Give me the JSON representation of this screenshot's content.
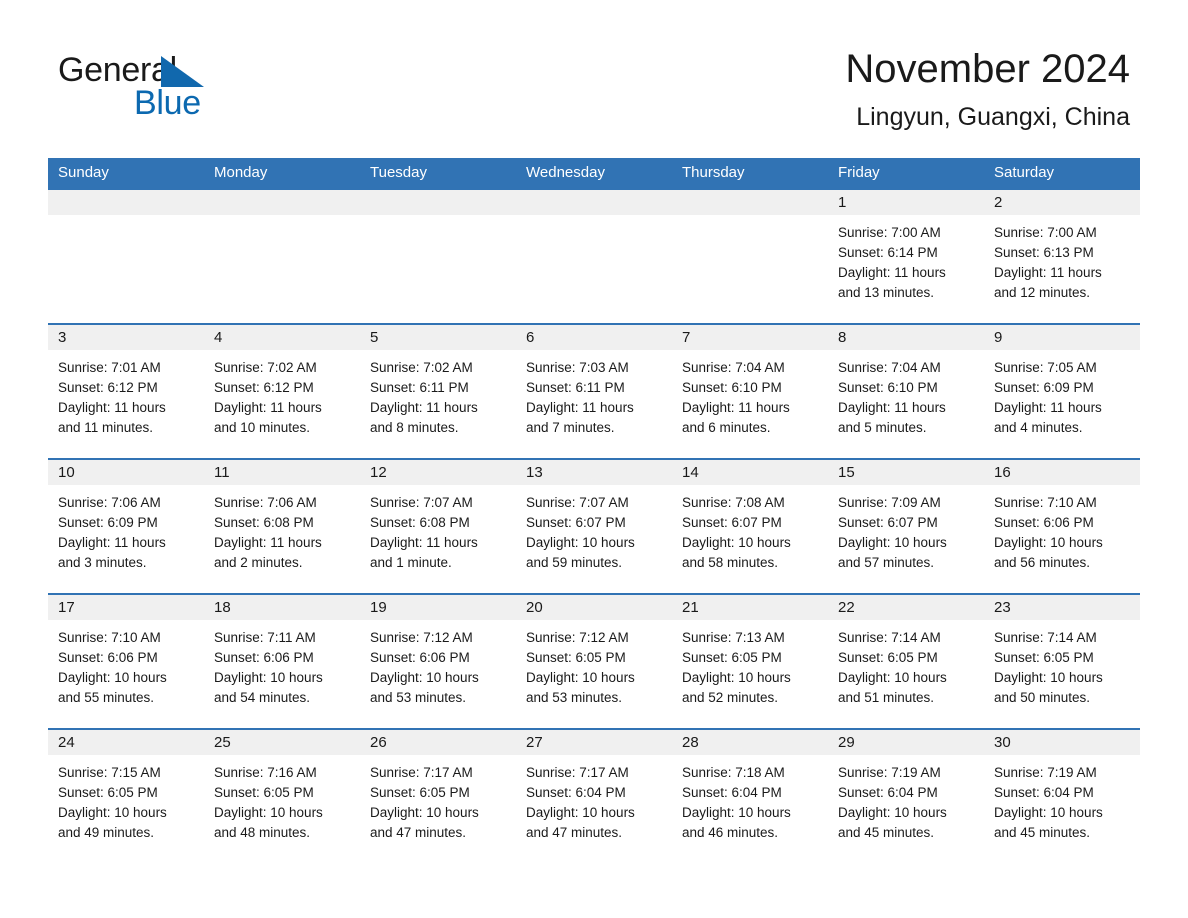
{
  "brand": {
    "name_part1": "General",
    "name_part2": "Blue",
    "triangle_color": "#1168ad",
    "text_color": "#1a1a1a"
  },
  "header": {
    "month_title": "November 2024",
    "location": "Lingyun, Guangxi, China"
  },
  "colors": {
    "header_blue": "#3173b4",
    "row_divider_blue": "#3173b4",
    "date_strip_gray": "#f0f0f0",
    "text": "#1a1a1a",
    "brand_blue": "#0c69b0"
  },
  "weekday_headers": [
    "Sunday",
    "Monday",
    "Tuesday",
    "Wednesday",
    "Thursday",
    "Friday",
    "Saturday"
  ],
  "weeks": [
    [
      {
        "day": "",
        "empty": true
      },
      {
        "day": "",
        "empty": true
      },
      {
        "day": "",
        "empty": true
      },
      {
        "day": "",
        "empty": true
      },
      {
        "day": "",
        "empty": true
      },
      {
        "day": "1",
        "sunrise": "Sunrise: 7:00 AM",
        "sunset": "Sunset: 6:14 PM",
        "daylight_line1": "Daylight: 11 hours",
        "daylight_line2": "and 13 minutes."
      },
      {
        "day": "2",
        "sunrise": "Sunrise: 7:00 AM",
        "sunset": "Sunset: 6:13 PM",
        "daylight_line1": "Daylight: 11 hours",
        "daylight_line2": "and 12 minutes."
      }
    ],
    [
      {
        "day": "3",
        "sunrise": "Sunrise: 7:01 AM",
        "sunset": "Sunset: 6:12 PM",
        "daylight_line1": "Daylight: 11 hours",
        "daylight_line2": "and 11 minutes."
      },
      {
        "day": "4",
        "sunrise": "Sunrise: 7:02 AM",
        "sunset": "Sunset: 6:12 PM",
        "daylight_line1": "Daylight: 11 hours",
        "daylight_line2": "and 10 minutes."
      },
      {
        "day": "5",
        "sunrise": "Sunrise: 7:02 AM",
        "sunset": "Sunset: 6:11 PM",
        "daylight_line1": "Daylight: 11 hours",
        "daylight_line2": "and 8 minutes."
      },
      {
        "day": "6",
        "sunrise": "Sunrise: 7:03 AM",
        "sunset": "Sunset: 6:11 PM",
        "daylight_line1": "Daylight: 11 hours",
        "daylight_line2": "and 7 minutes."
      },
      {
        "day": "7",
        "sunrise": "Sunrise: 7:04 AM",
        "sunset": "Sunset: 6:10 PM",
        "daylight_line1": "Daylight: 11 hours",
        "daylight_line2": "and 6 minutes."
      },
      {
        "day": "8",
        "sunrise": "Sunrise: 7:04 AM",
        "sunset": "Sunset: 6:10 PM",
        "daylight_line1": "Daylight: 11 hours",
        "daylight_line2": "and 5 minutes."
      },
      {
        "day": "9",
        "sunrise": "Sunrise: 7:05 AM",
        "sunset": "Sunset: 6:09 PM",
        "daylight_line1": "Daylight: 11 hours",
        "daylight_line2": "and 4 minutes."
      }
    ],
    [
      {
        "day": "10",
        "sunrise": "Sunrise: 7:06 AM",
        "sunset": "Sunset: 6:09 PM",
        "daylight_line1": "Daylight: 11 hours",
        "daylight_line2": "and 3 minutes."
      },
      {
        "day": "11",
        "sunrise": "Sunrise: 7:06 AM",
        "sunset": "Sunset: 6:08 PM",
        "daylight_line1": "Daylight: 11 hours",
        "daylight_line2": "and 2 minutes."
      },
      {
        "day": "12",
        "sunrise": "Sunrise: 7:07 AM",
        "sunset": "Sunset: 6:08 PM",
        "daylight_line1": "Daylight: 11 hours",
        "daylight_line2": "and 1 minute."
      },
      {
        "day": "13",
        "sunrise": "Sunrise: 7:07 AM",
        "sunset": "Sunset: 6:07 PM",
        "daylight_line1": "Daylight: 10 hours",
        "daylight_line2": "and 59 minutes."
      },
      {
        "day": "14",
        "sunrise": "Sunrise: 7:08 AM",
        "sunset": "Sunset: 6:07 PM",
        "daylight_line1": "Daylight: 10 hours",
        "daylight_line2": "and 58 minutes."
      },
      {
        "day": "15",
        "sunrise": "Sunrise: 7:09 AM",
        "sunset": "Sunset: 6:07 PM",
        "daylight_line1": "Daylight: 10 hours",
        "daylight_line2": "and 57 minutes."
      },
      {
        "day": "16",
        "sunrise": "Sunrise: 7:10 AM",
        "sunset": "Sunset: 6:06 PM",
        "daylight_line1": "Daylight: 10 hours",
        "daylight_line2": "and 56 minutes."
      }
    ],
    [
      {
        "day": "17",
        "sunrise": "Sunrise: 7:10 AM",
        "sunset": "Sunset: 6:06 PM",
        "daylight_line1": "Daylight: 10 hours",
        "daylight_line2": "and 55 minutes."
      },
      {
        "day": "18",
        "sunrise": "Sunrise: 7:11 AM",
        "sunset": "Sunset: 6:06 PM",
        "daylight_line1": "Daylight: 10 hours",
        "daylight_line2": "and 54 minutes."
      },
      {
        "day": "19",
        "sunrise": "Sunrise: 7:12 AM",
        "sunset": "Sunset: 6:06 PM",
        "daylight_line1": "Daylight: 10 hours",
        "daylight_line2": "and 53 minutes."
      },
      {
        "day": "20",
        "sunrise": "Sunrise: 7:12 AM",
        "sunset": "Sunset: 6:05 PM",
        "daylight_line1": "Daylight: 10 hours",
        "daylight_line2": "and 53 minutes."
      },
      {
        "day": "21",
        "sunrise": "Sunrise: 7:13 AM",
        "sunset": "Sunset: 6:05 PM",
        "daylight_line1": "Daylight: 10 hours",
        "daylight_line2": "and 52 minutes."
      },
      {
        "day": "22",
        "sunrise": "Sunrise: 7:14 AM",
        "sunset": "Sunset: 6:05 PM",
        "daylight_line1": "Daylight: 10 hours",
        "daylight_line2": "and 51 minutes."
      },
      {
        "day": "23",
        "sunrise": "Sunrise: 7:14 AM",
        "sunset": "Sunset: 6:05 PM",
        "daylight_line1": "Daylight: 10 hours",
        "daylight_line2": "and 50 minutes."
      }
    ],
    [
      {
        "day": "24",
        "sunrise": "Sunrise: 7:15 AM",
        "sunset": "Sunset: 6:05 PM",
        "daylight_line1": "Daylight: 10 hours",
        "daylight_line2": "and 49 minutes."
      },
      {
        "day": "25",
        "sunrise": "Sunrise: 7:16 AM",
        "sunset": "Sunset: 6:05 PM",
        "daylight_line1": "Daylight: 10 hours",
        "daylight_line2": "and 48 minutes."
      },
      {
        "day": "26",
        "sunrise": "Sunrise: 7:17 AM",
        "sunset": "Sunset: 6:05 PM",
        "daylight_line1": "Daylight: 10 hours",
        "daylight_line2": "and 47 minutes."
      },
      {
        "day": "27",
        "sunrise": "Sunrise: 7:17 AM",
        "sunset": "Sunset: 6:04 PM",
        "daylight_line1": "Daylight: 10 hours",
        "daylight_line2": "and 47 minutes."
      },
      {
        "day": "28",
        "sunrise": "Sunrise: 7:18 AM",
        "sunset": "Sunset: 6:04 PM",
        "daylight_line1": "Daylight: 10 hours",
        "daylight_line2": "and 46 minutes."
      },
      {
        "day": "29",
        "sunrise": "Sunrise: 7:19 AM",
        "sunset": "Sunset: 6:04 PM",
        "daylight_line1": "Daylight: 10 hours",
        "daylight_line2": "and 45 minutes."
      },
      {
        "day": "30",
        "sunrise": "Sunrise: 7:19 AM",
        "sunset": "Sunset: 6:04 PM",
        "daylight_line1": "Daylight: 10 hours",
        "daylight_line2": "and 45 minutes."
      }
    ]
  ]
}
